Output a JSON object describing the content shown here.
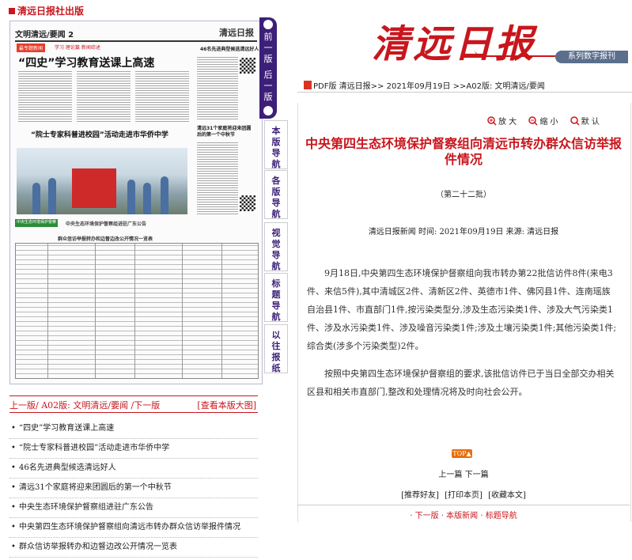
{
  "topbar": {
    "title": "清远日报社出版"
  },
  "preview": {
    "section": "文明清远/要闻",
    "page_no": "2",
    "logo": "清远日报",
    "tag": "最专题新闻",
    "tag2": "学习 理论篇 新闻综述",
    "headline1": "“四史”学习教育送课上高速",
    "headline2": "“院士专家科普进校园”活动走进市华侨中学",
    "right_head1": "46名先进典型候选清远好人",
    "right_head2": "清远31个家庭将迎来团圆后的第一个中秋节",
    "green_label": "中央生态环境保护督察",
    "strip": "中央生态环境保护督察组进驻广东公告",
    "mid_label": "群众信访举报转办和边督边改公开情况一览表"
  },
  "pagenav": {
    "prev": "前一版",
    "next": "后一版"
  },
  "side_nav": [
    {
      "label": "本版导航"
    },
    {
      "label": "各版导航"
    },
    {
      "label": "视觉导航"
    },
    {
      "label": "标题导航"
    },
    {
      "label": "以往报纸"
    }
  ],
  "page_row": {
    "left": "上一版/ A02版: 文明清远/要闻  /下一版",
    "right": "[查看本版大图]"
  },
  "articles": [
    "“四史”学习教育送课上高速",
    "“院士专家科普进校园”活动走进市华侨中学",
    "46名先进典型候选清远好人",
    "清远31个家庭将迎来团圆后的第一个中秋节",
    "中央生态环境保护督察组进驻广东公告",
    "中央第四生态环境保护督察组向清远市转办群众信访举报件情况",
    "群众信访举报转办和边督边改公开情况一览表"
  ],
  "masthead": {
    "title": "清远日报",
    "series": "系列数字报刊"
  },
  "breadcrumb": "PDF版 清远日报>> 2021年09月19日 >>A02版: 文明清远/要闻",
  "tools": {
    "zoom_in": "放 大",
    "zoom_out": "缩 小",
    "default": "默 认"
  },
  "article": {
    "title": "中央第四生态环境保护督察组向清远市转办群众信访举报件情况",
    "subtitle": "（第二十二批）",
    "meta": "清远日报新闻 时间: 2021年09月19日 来源: 清远日报",
    "p1": "9月18日,中央第四生态环境保护督察组向我市转办第22批信访件8件(来电3件、来信5件),其中清城区2件、清新区2件、英德市1件、佛冈县1件、连南瑶族自治县1件、市直部门1件,按污染类型分,涉及生态污染类1件、涉及大气污染类1件、涉及水污染类1件、涉及噪音污染类1件;涉及土壤污染类1件;其他污染类1件;综合类(涉多个污染类型)2件。",
    "p2": "按照中央第四生态环境保护督察组的要求,该批信访件已于当日全部交办相关区县和相关市直部门,整改和处理情况将及时向社会公开。"
  },
  "top_label": "TOP▲",
  "prevnext": "上一篇  下一篇",
  "actions": [
    "[推荐好友]",
    "[打印本页]",
    "[收藏本文]"
  ],
  "bottom_nav": "· 下一版 · 本版新闻 · 标题导航",
  "colors": {
    "accent": "#c8161d",
    "nav": "#3c1f78"
  }
}
